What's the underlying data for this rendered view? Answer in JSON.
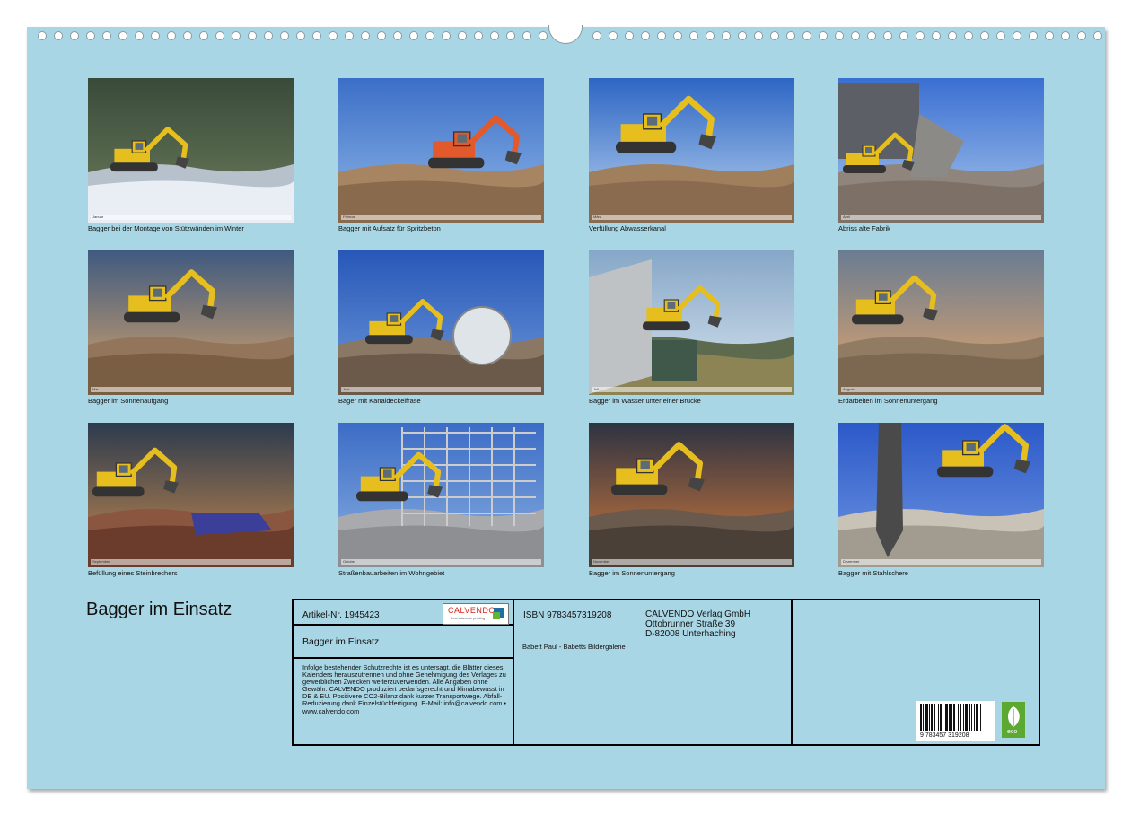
{
  "calendar": {
    "title": "Bagger im Einsatz",
    "months": [
      {
        "caption": "Bagger bei der Montage von Stützwänden im Winter",
        "scene": "snow",
        "strip_label": "Januar"
      },
      {
        "caption": "Bagger mit Aufsatz für Spritzbeton",
        "scene": "orange",
        "strip_label": "Februar"
      },
      {
        "caption": "Verfüllung Abwasserkanal",
        "scene": "blue-sky",
        "strip_label": "März"
      },
      {
        "caption": "Abriss alte Fabrik",
        "scene": "demolition",
        "strip_label": "April"
      },
      {
        "caption": "Bagger im Sonnenaufgang",
        "scene": "sunrise",
        "strip_label": "Mai"
      },
      {
        "caption": "Bager mit Kanaldeckelfräse",
        "scene": "mill",
        "strip_label": "Juni"
      },
      {
        "caption": "Bagger im Wasser unter einer Brücke",
        "scene": "bridge",
        "strip_label": "Juli"
      },
      {
        "caption": "Erdarbeiten im Sonnenuntergang",
        "scene": "sunset-earth",
        "strip_label": "August"
      },
      {
        "caption": "Befüllung eines Steinbrechers",
        "scene": "crusher",
        "strip_label": "September"
      },
      {
        "caption": "Straßenbauarbeiten im Wohngebiet",
        "scene": "scaffold",
        "strip_label": "Oktober"
      },
      {
        "caption": "Bagger im Sonnenuntergang",
        "scene": "sunset",
        "strip_label": "November"
      },
      {
        "caption": "Bagger mit Stahlschere",
        "scene": "shear",
        "strip_label": "Dezember"
      }
    ]
  },
  "info": {
    "article_no": "Artikel-Nr. 1945423",
    "logo_text": "CALVENDO",
    "logo_tagline": "best calendar printing",
    "book_title": "Bagger im Einsatz",
    "legal_text": "Infolge bestehender Schutzrechte ist es untersagt, die Blätter dieses Kalenders herauszutrennen und ohne Genehmigung des Verlages zu gewerblichen Zwecken weiterzuverwenden. Alle Angaben ohne Gewähr. CALVENDO produziert bedarfsgerecht und klimabewusst in DE & EU. Positivere CO2-Bilanz dank kurzer Transportwege. Abfall-Reduzierung dank Einzelstückfertigung. E-Mail: info@calvendo.com • www.calvendo.com",
    "isbn": "ISBN 9783457319208",
    "publisher_name": "CALVENDO Verlag GmbH",
    "publisher_street": "Ottobrunner Straße 39",
    "publisher_city": "D-82008 Unterhaching",
    "author": "Babett Paul - Babetts Bildergalerie",
    "barcode_number": "9 783457 319208",
    "eco_label": "eco"
  },
  "colors": {
    "page_background": "#a9d6e4",
    "excavator_yellow": "#e6be1e",
    "logo_red": "#d9261c"
  }
}
